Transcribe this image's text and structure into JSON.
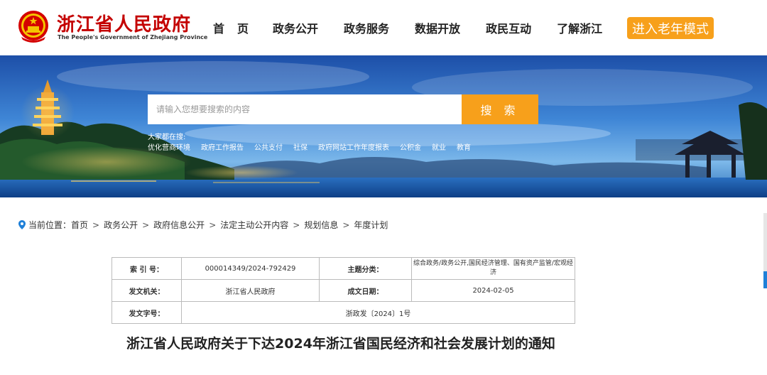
{
  "header": {
    "site_title": "浙江省人民政府",
    "site_subtitle": "The People's Government of Zhejiang Province",
    "nav": [
      "首页",
      "政务公开",
      "政务服务",
      "数据开放",
      "政民互动",
      "了解浙江"
    ],
    "elder_mode_label": "进入老年模式"
  },
  "search": {
    "placeholder": "请输入您想要搜索的内容",
    "button_label": "搜 索",
    "hot_label": "大家都在搜:",
    "hot_terms": [
      "优化营商环境",
      "政府工作报告",
      "公共支付",
      "社保",
      "政府网站工作年度报表",
      "公积金",
      "就业",
      "教育"
    ]
  },
  "breadcrumb": {
    "prefix": "当前位置：",
    "items": [
      "首页",
      "政务公开",
      "政府信息公开",
      "法定主动公开内容",
      "规划信息",
      "年度计划"
    ],
    "separator": ">"
  },
  "info_table": {
    "index_label": "索 引 号：",
    "index_value": "000014349/2024-792429",
    "topic_label": "主题分类：",
    "topic_value": "综合政务/政务公开,国民经济管理、国有资产监管/宏观经济",
    "issuer_label": "发文机关：",
    "issuer_value": "浙江省人民政府",
    "date_label": "成文日期：",
    "date_value": "2024-02-05",
    "docno_label": "发文字号：",
    "docno_value": "浙政发〔2024〕1号"
  },
  "document": {
    "title": "浙江省人民政府关于下达2024年浙江省国民经济和社会发展计划的通知"
  },
  "colors": {
    "brand_red": "#c40000",
    "accent_orange": "#f7a01b"
  },
  "icons": {
    "emblem": "national-emblem-icon",
    "location": "location-pin-icon"
  }
}
